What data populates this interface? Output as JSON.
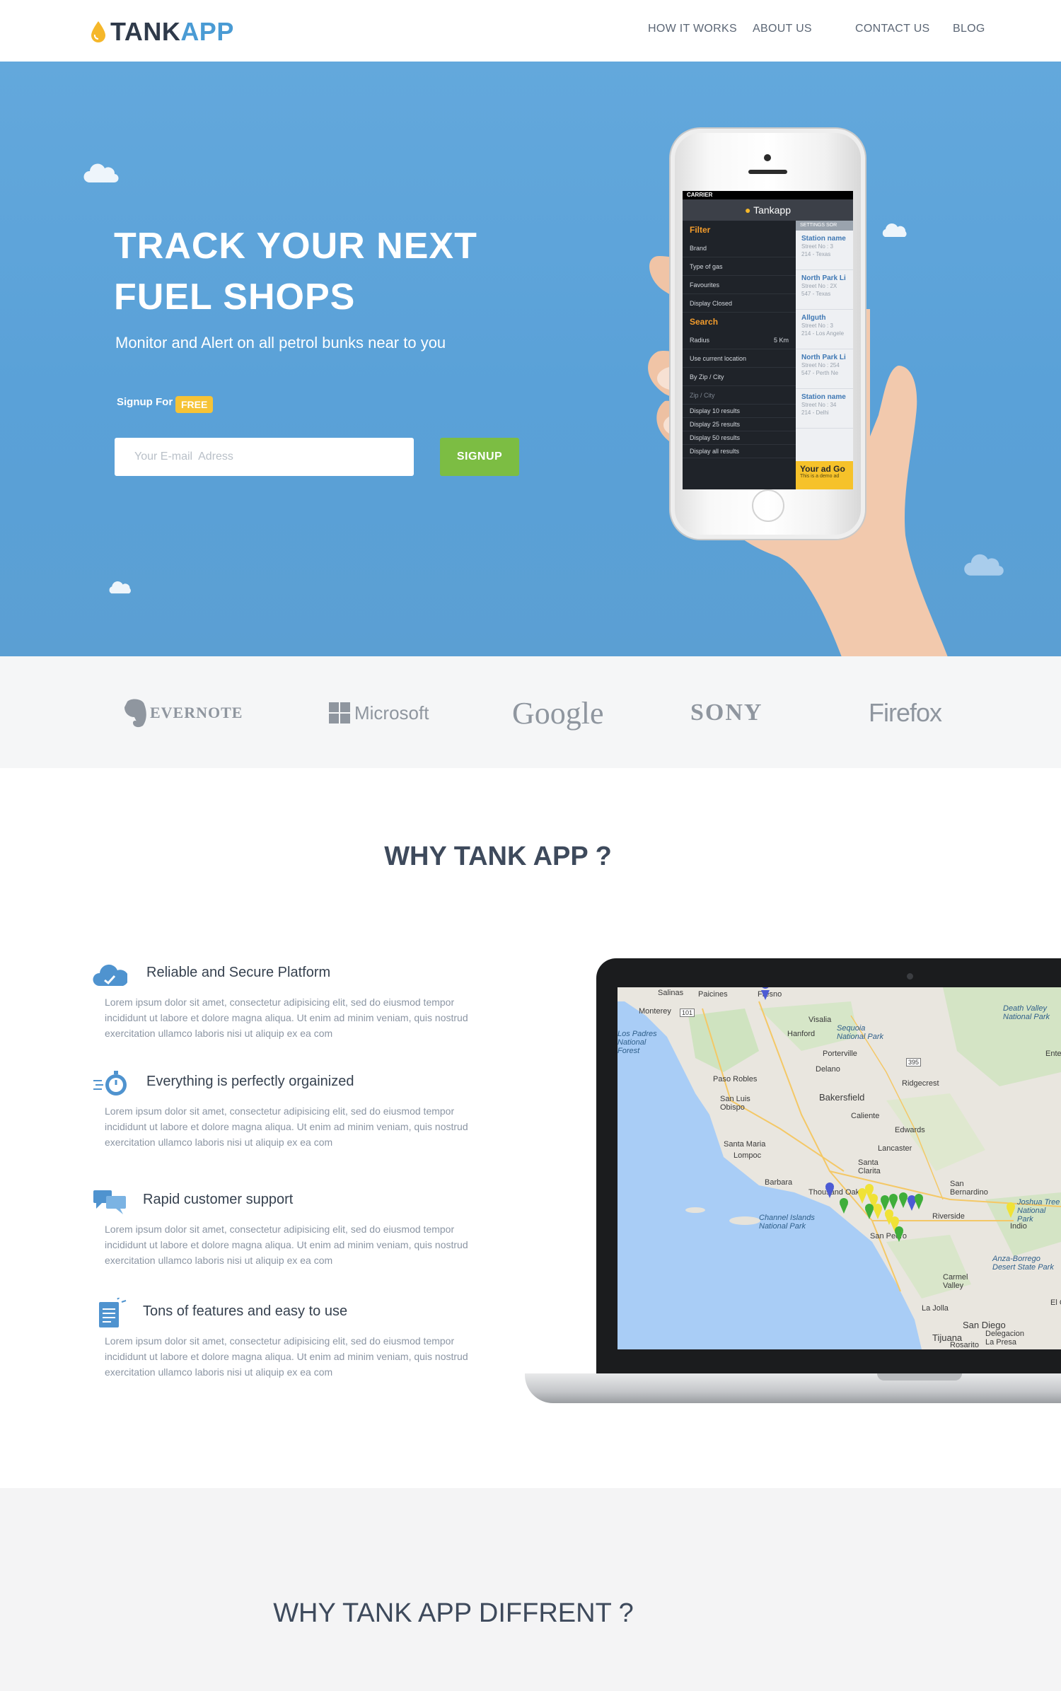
{
  "brand": {
    "part1": "TANK",
    "part2": "APP"
  },
  "nav": {
    "items": [
      {
        "label": "HOW IT WORKS"
      },
      {
        "label": "ABOUT US"
      },
      {
        "label": "CONTACT US"
      },
      {
        "label": "BLOG"
      }
    ]
  },
  "hero": {
    "title_line1": "TRACK YOUR NEXT",
    "title_line2": "FUEL SHOPS",
    "subtitle": "Monitor and Alert on all petrol bunks near to you",
    "signup_for": "Signup For",
    "free_badge": "FREE",
    "email_placeholder": "Your E-mail  Adress",
    "signup_button": "SIGNUP"
  },
  "phone_app": {
    "carrier": "CARRIER",
    "app_name": "Tankapp",
    "filter_label": "Filter",
    "filter_rows": [
      "Brand",
      "Type of gas",
      "Favourites",
      "Display Closed"
    ],
    "search_label": "Search",
    "radius_label": "Radius",
    "radius_value": "5 Km",
    "options": [
      "Use current location",
      "By Zip / City"
    ],
    "zip_placeholder": "Zip / City",
    "display_options": [
      "Display 10 results",
      "Display 25 results",
      "Display 50 results",
      "Display all results"
    ],
    "tabs": [
      "SETTINGS",
      "SOR"
    ],
    "stations": [
      {
        "name": "Station name",
        "line1": "Street No : 3",
        "line2": "214 - Texas"
      },
      {
        "name": "North Park Li",
        "line1": "Street No : 2X",
        "line2": "547 - Texas"
      },
      {
        "name": "Allguth",
        "line1": "Street No : 3",
        "line2": "214 - Los Angele"
      },
      {
        "name": "North Park Li",
        "line1": "Street No : 254",
        "line2": "547 - Perth Ne"
      },
      {
        "name": "Station name",
        "line1": "Street No : 34",
        "line2": "214 - Delhi"
      }
    ],
    "ad_title": "Your ad Go",
    "ad_sub": "This is a demo ad"
  },
  "partners": [
    "EVERNOTE",
    "Microsoft",
    "Google",
    "SONY",
    "Firefox"
  ],
  "why": {
    "title": "WHY TANK APP ?",
    "features": [
      {
        "icon": "cloud-icon",
        "title": "Reliable and Secure Platform",
        "body": "Lorem ipsum dolor sit amet, consectetur adipisicing elit, sed do eiusmod tempor incididunt ut labore et dolore magna aliqua. Ut enim ad minim veniam, quis nostrud exercitation ullamco laboris nisi ut aliquip ex ea com"
      },
      {
        "icon": "stopwatch-icon",
        "title": "Everything is perfectly orgainized",
        "body": "Lorem ipsum dolor sit amet, consectetur adipisicing elit, sed do eiusmod tempor incididunt ut labore et dolore magna aliqua. Ut enim ad minim veniam, quis nostrud exercitation ullamco laboris nisi ut aliquip ex ea com"
      },
      {
        "icon": "chat-bubbles-icon",
        "title": "Rapid customer support",
        "body": "Lorem ipsum dolor sit amet, consectetur adipisicing elit, sed do eiusmod tempor incididunt ut labore et dolore magna aliqua. Ut enim ad minim veniam, quis nostrud exercitation ullamco laboris nisi ut aliquip ex ea com"
      },
      {
        "icon": "document-icon",
        "title": "Tons of features and easy to use",
        "body": "Lorem ipsum dolor sit amet, consectetur adipisicing elit, sed do eiusmod tempor incididunt ut labore et dolore magna aliqua. Ut enim ad minim veniam, quis nostrud exercitation ullamco laboris nisi ut aliquip ex ea com"
      }
    ]
  },
  "map": {
    "labels": [
      "Salinas",
      "Paicines",
      "Fresno",
      "Monterey",
      "Visalia",
      "Hanford",
      "Sequoia National Park",
      "Porterville",
      "Los Padres National Forest",
      "Delano",
      "Paso Robles",
      "Bakersfield",
      "Ridgecrest",
      "San Luis Obispo",
      "Caliente",
      "Edwards",
      "Santa Maria",
      "Lompoc",
      "Lancaster",
      "Santa Clarita",
      "Barbara",
      "Thousand Oaks",
      "Channel Islands National Park",
      "San Bernardino",
      "Riverside",
      "San Pedro",
      "Joshua Tree National Park",
      "Indio",
      "Anza-Borrego Desert State Park",
      "Carmel Valley",
      "La Jolla",
      "San Diego",
      "Tijuana",
      "Delegacion La Presa",
      "Rosarito",
      "Death Valley National Park",
      "Ente",
      "El C",
      "101",
      "395"
    ]
  },
  "colors": {
    "hero": "#5ba2d9",
    "accent": "#4a9bd4",
    "signup": "#7cbd43",
    "free": "#f6c336"
  },
  "different": {
    "title": "WHY TANK APP DIFFRENT ?"
  }
}
